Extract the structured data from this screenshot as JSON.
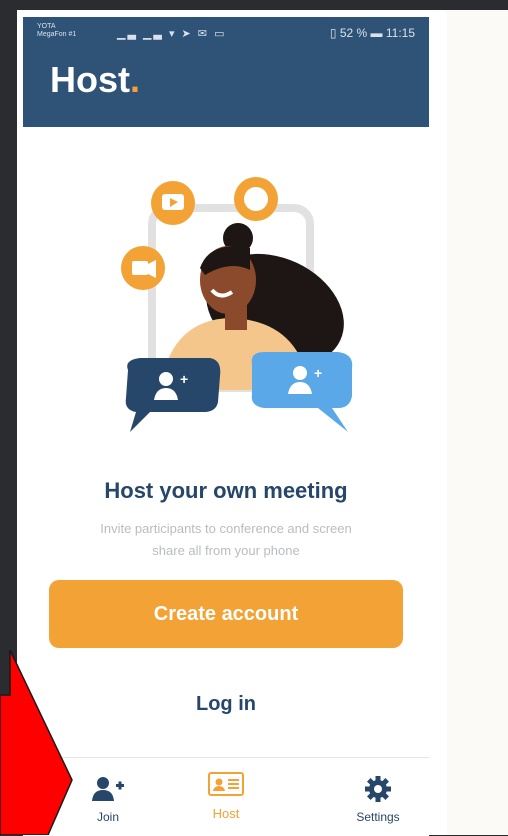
{
  "status_bar": {
    "carrier_line1": "YOTA",
    "carrier_line2": "MegaFon #1",
    "network_icons": "▁▃ ▁▃ ▾ ➤ ✉ ▭",
    "battery_text": "52 %",
    "time": "11:15"
  },
  "app_bar": {
    "title": "Host",
    "title_dot": "."
  },
  "main": {
    "headline": "Host your own meeting",
    "subtext": "Invite participants to conference and screen share all from your phone",
    "create_account_label": "Create account",
    "login_label": "Log in"
  },
  "tabs": [
    {
      "label": "Join",
      "icon": "add-person-icon",
      "active": false
    },
    {
      "label": "Host",
      "icon": "id-card-icon",
      "active": true
    },
    {
      "label": "Settings",
      "icon": "gear-icon",
      "active": false
    }
  ],
  "colors": {
    "app_bar": "#2f5377",
    "accent": "#f3a236",
    "text_primary": "#26466a",
    "text_muted": "#b8bcc2",
    "arrow": "#ff0000"
  }
}
